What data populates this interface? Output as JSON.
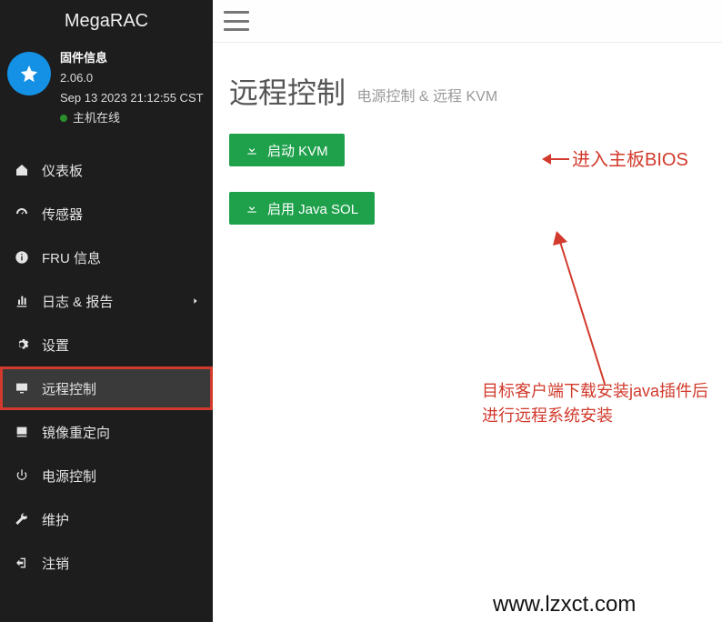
{
  "brand": "MegaRAC",
  "firmware": {
    "title": "固件信息",
    "version": "2.06.0",
    "timestamp": "Sep 13 2023 21:12:55 CST",
    "status": "主机在线"
  },
  "sidebar": {
    "items": [
      {
        "label": "仪表板"
      },
      {
        "label": "传感器"
      },
      {
        "label": "FRU 信息"
      },
      {
        "label": "日志 & 报告",
        "expandable": true
      },
      {
        "label": "设置"
      },
      {
        "label": "远程控制",
        "active": true,
        "highlight": true
      },
      {
        "label": "镜像重定向"
      },
      {
        "label": "电源控制"
      },
      {
        "label": "维护"
      },
      {
        "label": "注销"
      }
    ]
  },
  "page": {
    "title": "远程控制",
    "subtitle": "电源控制 & 远程 KVM"
  },
  "buttons": {
    "kvm": "启动 KVM",
    "sol": "启用 Java SOL"
  },
  "annotations": {
    "a1": "进入主板BIOS",
    "a2": "目标客户端下载安装java插件后进行远程系统安装"
  },
  "watermark": "www.lzxct.com"
}
